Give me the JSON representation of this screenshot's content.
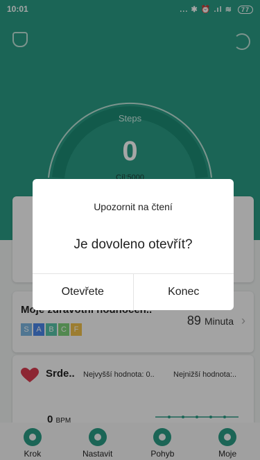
{
  "status_bar": {
    "time": "10:01",
    "icons": "... ✱ ⏰ .ıl ≋",
    "battery": "77"
  },
  "colors": {
    "accent": "#2a9c84",
    "grade_s": "#7bb6e0",
    "grade_a": "#4a86e8",
    "grade_b": "#56c3a8",
    "grade_c": "#7fd17a",
    "grade_f": "#f0c04a",
    "heart": "#d93b4f"
  },
  "header": {
    "left_icon": "trophy-icon",
    "right_icon": "refresh-icon"
  },
  "steps": {
    "label": "Steps",
    "value": "0",
    "goal": "Cíl:5000",
    "progress": 0
  },
  "health_card": {
    "title": "Moje zdravotní hodnocen..",
    "grades": [
      "S",
      "A",
      "B",
      "C",
      "F"
    ],
    "value": "89",
    "unit": "Minuta"
  },
  "heart_card": {
    "title": "Srde..",
    "max_label": "Nejvyšší hodnota: 0..",
    "min_label": "Nejnižší hodnota:..",
    "bpm_value": "0",
    "bpm_unit": "BPM"
  },
  "bottom_nav": [
    {
      "label": "Krok",
      "icon": "footprint-icon"
    },
    {
      "label": "Nastavit",
      "icon": "watch-icon"
    },
    {
      "label": "Pohyb",
      "icon": "run-icon"
    },
    {
      "label": "Moje",
      "icon": "user-icon"
    }
  ],
  "dialog": {
    "title": "Upozornit na čtení",
    "message": "Je dovoleno otevřít?",
    "confirm": "Otevřete",
    "cancel": "Konec"
  }
}
